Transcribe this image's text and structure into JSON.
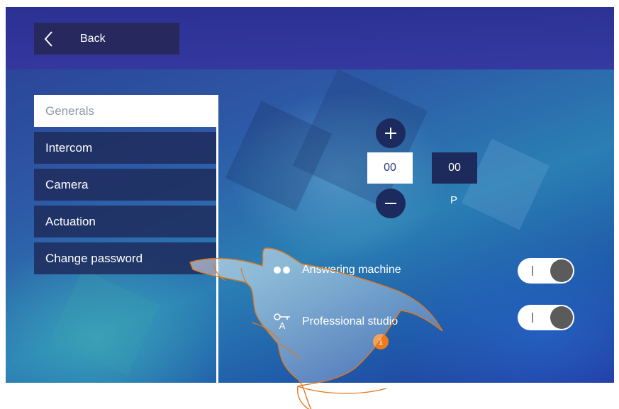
{
  "header": {
    "back_label": "Back"
  },
  "sidebar": {
    "items": [
      {
        "label": "Generals",
        "active": true
      },
      {
        "label": "Intercom",
        "active": false
      },
      {
        "label": "Camera",
        "active": false
      },
      {
        "label": "Actuation",
        "active": false
      },
      {
        "label": "Change password",
        "active": false
      }
    ]
  },
  "address": {
    "left_value": "00",
    "right_value": "00",
    "right_label": "P"
  },
  "options": [
    {
      "label": "Answering machine",
      "icon": "answering-machine-icon",
      "toggle": "off"
    },
    {
      "label": "Professional studio",
      "icon": "professional-studio-icon",
      "icon_letter": "A",
      "toggle": "off"
    }
  ],
  "toggle_mark": "I",
  "callout": {
    "number": "1"
  },
  "colors": {
    "accent": "#ef7a1a",
    "panel_dark": "#1c2a5c",
    "topbar": "#2b2f93"
  }
}
